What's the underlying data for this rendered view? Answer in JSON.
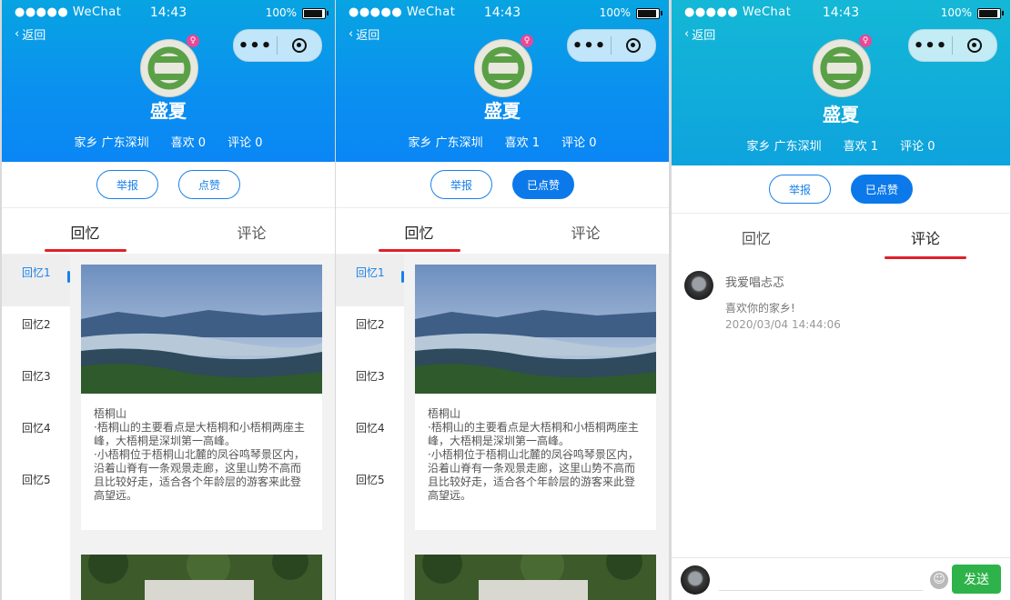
{
  "colors": {
    "header_blue": "#0a8ff0",
    "accent": "#0b79ea",
    "tab_underline": "#e0202a",
    "send_green": "#2eb34a",
    "gender_pink": "#e84896"
  },
  "statusbar": {
    "signal": "●●●●● WeChat",
    "time": "14:43",
    "battery": "100%",
    "battery_level": 1.0
  },
  "nav": {
    "back": "返回"
  },
  "profile": {
    "name": "盛夏",
    "hometown": "家乡 广东深圳",
    "gender_icon": "female-icon"
  },
  "screens": [
    {
      "likes": "喜欢 0",
      "comments": "评论 0",
      "like_button": "点赞",
      "liked": false
    },
    {
      "likes": "喜欢 1",
      "comments": "评论 0",
      "like_button": "已点赞",
      "liked": true
    },
    {
      "likes": "喜欢 1",
      "comments": "评论 0",
      "like_button": "已点赞",
      "liked": true
    }
  ],
  "buttons": {
    "report": "举报"
  },
  "tabs": {
    "memory": "回忆",
    "comment": "评论"
  },
  "sidebar": {
    "items": [
      "回忆1",
      "回忆2",
      "回忆3",
      "回忆4",
      "回忆5"
    ]
  },
  "memory_card": {
    "title": "梧桐山",
    "para1": "·梧桐山的主要看点是大梧桐和小梧桐两座主峰，大梧桐是深圳第一高峰。",
    "para2": "·小梧桐位于梧桐山北麓的凤谷鸣琴景区内，沿着山脊有一条观景走廊，这里山势不高而且比较好走，适合各个年龄层的游客来此登高望远。"
  },
  "comment": {
    "user": "我爱唱忐忑",
    "text": "喜欢你的家乡!",
    "time": "2020/03/04 14:44:06"
  },
  "input": {
    "send": "发送",
    "emoji_icon": "smile-icon"
  }
}
